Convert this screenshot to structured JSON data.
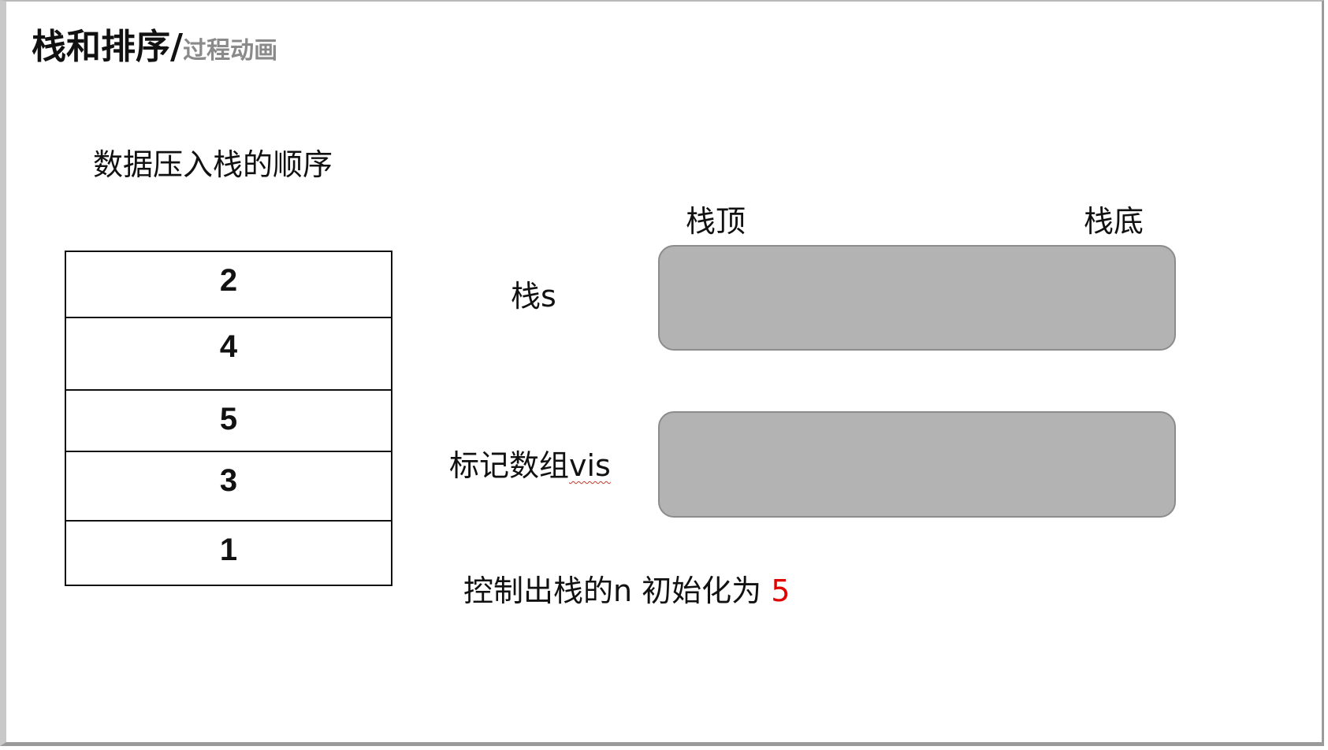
{
  "header": {
    "title_main": "栈和排序/",
    "title_sub": "过程动画"
  },
  "diagram": {
    "push_order_caption": "数据压入栈的顺序",
    "push_order_values": [
      "2",
      "4",
      "5",
      "3",
      "1"
    ],
    "stack_top_label": "栈顶",
    "stack_bottom_label": "栈底",
    "stack_label": "栈s",
    "vis_label_prefix": "标记数组",
    "vis_label_var": "vis",
    "control_text": "控制出栈的n 初始化为 ",
    "control_value": "5",
    "highlight_color": "#e00000",
    "box_fill_color": "#b3b3b3"
  }
}
